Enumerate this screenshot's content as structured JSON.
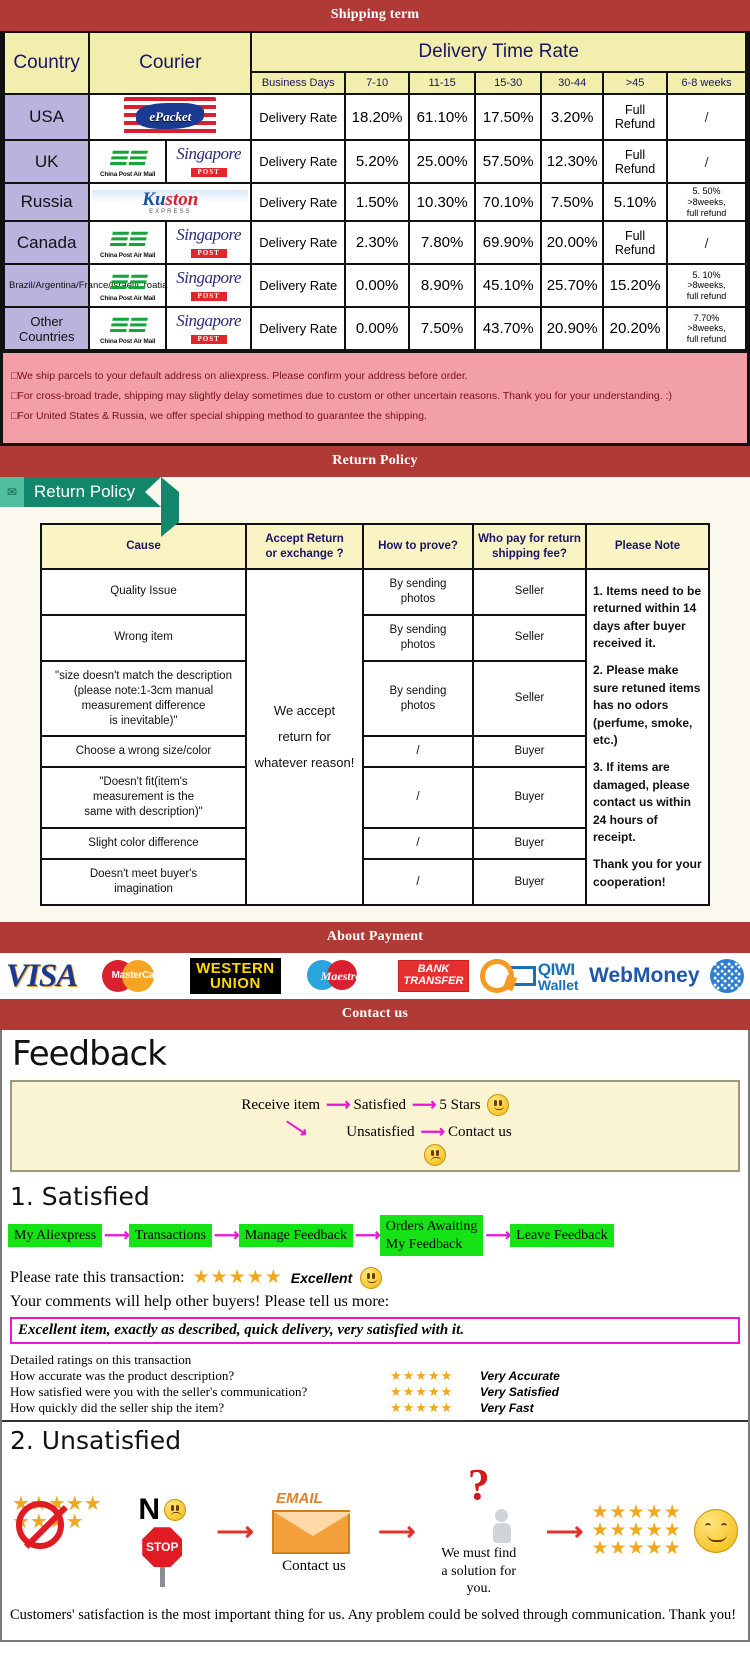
{
  "banners": {
    "shipping": "Shipping term",
    "return": "Return Policy",
    "payment": "About Payment",
    "contact": "Contact us"
  },
  "shipping": {
    "headers": {
      "country": "Country",
      "courier": "Courier",
      "group": "Delivery Time Rate",
      "business_days": "Business Days",
      "ranges": [
        "7-10",
        "11-15",
        "15-30",
        "30-44",
        ">45",
        "6-8 weeks"
      ]
    },
    "rate_label": "Delivery Rate",
    "rows": [
      {
        "country": "USA",
        "couriers": [
          "epacket"
        ],
        "values": [
          "18.20%",
          "61.10%",
          "17.50%",
          "3.20%",
          "Full Refund",
          "/"
        ]
      },
      {
        "country": "UK",
        "couriers": [
          "china-post-air-mail",
          "singapore-post"
        ],
        "values": [
          "5.20%",
          "25.00%",
          "57.50%",
          "12.30%",
          "Full Refund",
          "/"
        ]
      },
      {
        "country": "Russia",
        "couriers": [
          "ruston-express"
        ],
        "values": [
          "1.50%",
          "10.30%",
          "70.10%",
          "7.50%",
          "5.10%",
          "5. 50%\n>8weeks,\nfull refund"
        ]
      },
      {
        "country": "Canada",
        "couriers": [
          "china-post-air-mail",
          "singapore-post"
        ],
        "values": [
          "2.30%",
          "7.80%",
          "69.90%",
          "20.00%",
          "Full Refund",
          "/"
        ]
      },
      {
        "country": "Brazil/Argentina/France/Israel/Croatia",
        "couriers": [
          "china-post-air-mail",
          "singapore-post"
        ],
        "values": [
          "0.00%",
          "8.90%",
          "45.10%",
          "25.70%",
          "15.20%",
          "5. 10%\n>8weeks,\nfull refund"
        ]
      },
      {
        "country": "Other Countries",
        "couriers": [
          "china-post-air-mail",
          "singapore-post"
        ],
        "values": [
          "0.00%",
          "7.50%",
          "43.70%",
          "20.90%",
          "20.20%",
          "7.70%\n>8weeks,\nfull refund"
        ]
      }
    ],
    "notices": [
      "We ship parcels to your default address on aliexpress. Please confirm your address before order.",
      "For cross-broad trade, shipping may slightly delay sometimes due to custom or other uncertain reasons. Thank you for your understanding. :)",
      "For United States & Russia, we offer special shipping method to guarantee the shipping."
    ],
    "logo_text": {
      "epacket": "ePacket",
      "china_post_main": "China Post Air Mail",
      "singapore_post_1": "Singapore",
      "singapore_post_2": "POST",
      "ruston_1": "Ku",
      "ruston_2": "ston",
      "ruston_sub": "EXPRESS"
    }
  },
  "return_policy": {
    "ribbon_title": "Return Policy",
    "ribbon_icon": "✉",
    "headers": [
      "Cause",
      "Accept Return\nor exchange ?",
      "How to prove?",
      "Who pay for return\nshipping fee?",
      "Please Note"
    ],
    "accept_cell": "We accept\nreturn for\nwhatever reason!",
    "rows": [
      {
        "cause": "Quality Issue",
        "prove": "By sending\nphotos",
        "who": "Seller"
      },
      {
        "cause": "Wrong item",
        "prove": "By sending\nphotos",
        "who": "Seller"
      },
      {
        "cause": "\"size doesn't match the description\n(please note:1-3cm manual\nmeasurement difference\nis inevitable)\"",
        "prove": "By sending\nphotos",
        "who": "Seller"
      },
      {
        "cause": "Choose a wrong size/color",
        "prove": "/",
        "who": "Buyer"
      },
      {
        "cause": "\"Doesn't fit(item's\nmeasurement is the\nsame with description)\"",
        "prove": "/",
        "who": "Buyer"
      },
      {
        "cause": "Slight color difference",
        "prove": "/",
        "who": "Buyer"
      },
      {
        "cause": "Doesn't meet buyer's\nimagination",
        "prove": "/",
        "who": "Buyer"
      }
    ],
    "notes": [
      "1. Items need to be returned within 14 days after buyer received it.",
      "2. Please make sure retuned items has no odors (perfume, smoke, etc.)",
      "3. If items are damaged, please contact us within 24 hours of receipt.",
      "Thank you for your cooperation!"
    ]
  },
  "payment": {
    "methods": [
      {
        "name": "visa",
        "label": "VISA"
      },
      {
        "name": "mastercard",
        "label": "MasterCard"
      },
      {
        "name": "western-union",
        "line1": "WESTERN",
        "line2": "UNION"
      },
      {
        "name": "maestro",
        "label": "Maestro"
      },
      {
        "name": "bank-transfer",
        "line1": "BANK",
        "line2": "TRANSFER"
      },
      {
        "name": "qiwi-wallet",
        "line1": "QIWI",
        "line2": "Wallet"
      },
      {
        "name": "webmoney",
        "label": "WebMoney"
      },
      {
        "name": "webmoney-globe",
        "label": ""
      }
    ]
  },
  "feedback": {
    "title": "Feedback",
    "flow": {
      "receive": "Receive item",
      "satisfied": "Satisfied",
      "five_stars": "5 Stars",
      "unsatisfied": "Unsatisfied",
      "contact_us": "Contact us"
    },
    "satisfied_head": "1. Satisfied",
    "steps": [
      "My Aliexpress",
      "Transactions",
      "Manage Feedback",
      "Orders Awaiting\nMy Feedback",
      "Leave Feedback"
    ],
    "rate_label": "Please rate this transaction:",
    "rate_stars": "★★★★★",
    "rate_word": "Excellent",
    "tell_more": "Your comments will help other buyers! Please tell us more:",
    "comment": "Excellent item, exactly as described, quick delivery, very satisfied with it.",
    "detailed_head": "Detailed ratings on this transaction",
    "detailed": [
      {
        "question": "How accurate was the product description?",
        "stars": "★★★★★",
        "value": "Very Accurate"
      },
      {
        "question": "How satisfied were you with the seller's communication?",
        "stars": "★★★★★",
        "value": "Very Satisfied"
      },
      {
        "question": "How quickly did the seller ship the item?",
        "stars": "★★★★★",
        "value": "Very Fast"
      }
    ],
    "unsatisfied_head": "2. Unsatisfied",
    "unsat": {
      "no_label": "N",
      "stop_label": "STOP",
      "email_label": "EMAIL",
      "contact_caption": "Contact us",
      "solution_caption": "We must find\na solution for\nyou.",
      "stars_block": "★★★★★"
    },
    "closing": "Customers' satisfaction is the most important thing for us. Any problem could be solved through communication. Thank you!"
  }
}
